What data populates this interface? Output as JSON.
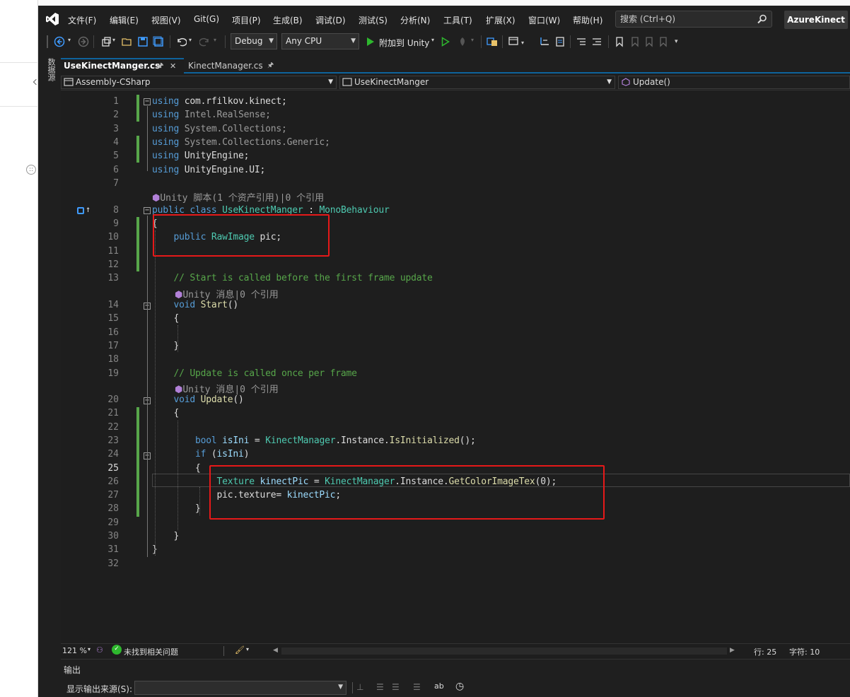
{
  "menu": {
    "items": [
      "文件(F)",
      "编辑(E)",
      "视图(V)",
      "Git(G)",
      "项目(P)",
      "生成(B)",
      "调试(D)",
      "测试(S)",
      "分析(N)",
      "工具(T)",
      "扩展(X)",
      "窗口(W)",
      "帮助(H)"
    ],
    "search_placeholder": "搜索 (Ctrl+Q)",
    "solution_name": "AzureKinect"
  },
  "toolbar": {
    "config": "Debug",
    "platform": "Any CPU",
    "attach_label": "附加到 Unity"
  },
  "sidebar": {
    "data_source_tab": "数据源"
  },
  "tabs": [
    {
      "label": "UseKinectManger.cs",
      "active": true
    },
    {
      "label": "KinectManager.cs",
      "active": false
    }
  ],
  "navbar": {
    "project": "Assembly-CSharp",
    "class": "UseKinectManger",
    "member": "Update()"
  },
  "code": {
    "line_numbers": [
      "1",
      "2",
      "3",
      "4",
      "5",
      "6",
      "7",
      "8",
      "9",
      "10",
      "11",
      "12",
      "13",
      "14",
      "15",
      "16",
      "17",
      "18",
      "19",
      "20",
      "21",
      "22",
      "23",
      "24",
      "25",
      "26",
      "27",
      "28",
      "29",
      "30",
      "31",
      "32"
    ],
    "current_line": "25",
    "lens": {
      "class_refs": "Unity 脚本(1 个资产引用)|0 个引用",
      "start_refs": "Unity 消息|0 个引用",
      "update_refs": "Unity 消息|0 个引用"
    },
    "lines": {
      "l1": [
        [
          "kw",
          "using"
        ],
        [
          "pl",
          " com.rfilkov.kinect;"
        ]
      ],
      "l2": [
        [
          "kw",
          "using"
        ],
        [
          "gr",
          " Intel.RealSense;"
        ]
      ],
      "l3": [
        [
          "kw",
          "using"
        ],
        [
          "gr",
          " System.Collections;"
        ]
      ],
      "l4": [
        [
          "kw",
          "using"
        ],
        [
          "gr",
          " System.Collections.Generic;"
        ]
      ],
      "l5": [
        [
          "kw",
          "using"
        ],
        [
          "pl",
          " UnityEngine;"
        ]
      ],
      "l6": [
        [
          "kw",
          "using"
        ],
        [
          "pl",
          " UnityEngine.UI;"
        ]
      ],
      "l8": [
        [
          "kw",
          "public class "
        ],
        [
          "ty",
          "UseKinectManger"
        ],
        [
          "pl",
          " : "
        ],
        [
          "ty",
          "MonoBehaviour"
        ]
      ],
      "l9": [
        [
          "pl",
          "{"
        ]
      ],
      "l10": [
        [
          "pl",
          "    "
        ],
        [
          "kw",
          "public "
        ],
        [
          "ty",
          "RawImage"
        ],
        [
          "pl",
          " pic;"
        ]
      ],
      "l13": [
        [
          "cm",
          "    // Start is called before the first frame update"
        ]
      ],
      "l14": [
        [
          "pl",
          "    "
        ],
        [
          "kw",
          "void "
        ],
        [
          "fn",
          "Start"
        ],
        [
          "pl",
          "()"
        ]
      ],
      "l15": [
        [
          "pl",
          "    {"
        ]
      ],
      "l17": [
        [
          "pl",
          "    }"
        ]
      ],
      "l19": [
        [
          "cm",
          "    // Update is called once per frame"
        ]
      ],
      "l20": [
        [
          "pl",
          "    "
        ],
        [
          "kw",
          "void "
        ],
        [
          "fn",
          "Update"
        ],
        [
          "pl",
          "()"
        ]
      ],
      "l21": [
        [
          "pl",
          "    {"
        ]
      ],
      "l23": [
        [
          "pl",
          "        "
        ],
        [
          "kw",
          "bool "
        ],
        [
          "id",
          "isIni"
        ],
        [
          "pl",
          " = "
        ],
        [
          "ty",
          "KinectManager"
        ],
        [
          "pl",
          ".Instance."
        ],
        [
          "fn",
          "IsInitialized"
        ],
        [
          "pl",
          "();"
        ]
      ],
      "l24": [
        [
          "pl",
          "        "
        ],
        [
          "kw",
          "if "
        ],
        [
          "pl",
          "("
        ],
        [
          "id",
          "isIni"
        ],
        [
          "pl",
          ")"
        ]
      ],
      "l25": [
        [
          "pl",
          "        {"
        ]
      ],
      "l26": [
        [
          "pl",
          "            "
        ],
        [
          "ty",
          "Texture"
        ],
        [
          "pl",
          " "
        ],
        [
          "id",
          "kinectPic"
        ],
        [
          "pl",
          " = "
        ],
        [
          "ty",
          "KinectManager"
        ],
        [
          "pl",
          ".Instance."
        ],
        [
          "fn",
          "GetColorImageTex"
        ],
        [
          "pl",
          "(0);"
        ]
      ],
      "l27": [
        [
          "pl",
          "            pic.texture= "
        ],
        [
          "id",
          "kinectPic"
        ],
        [
          "pl",
          ";"
        ]
      ],
      "l28": [
        [
          "pl",
          "        }"
        ]
      ],
      "l30": [
        [
          "pl",
          "    }"
        ]
      ],
      "l31": [
        [
          "pl",
          "}"
        ]
      ]
    }
  },
  "status": {
    "zoom": "121 %",
    "issues": "未找到相关问题",
    "line": "行: 25",
    "col": "字符: 10"
  },
  "output": {
    "title": "输出",
    "source_label": "显示输出来源(S):",
    "source_value": ""
  }
}
